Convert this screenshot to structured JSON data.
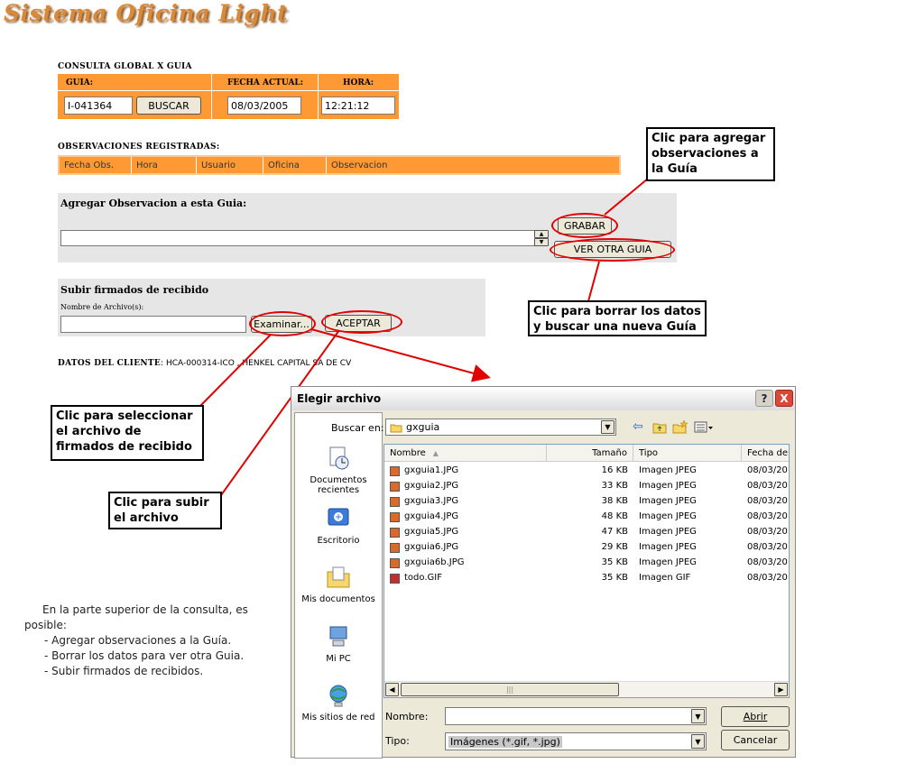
{
  "app": {
    "title": "Sistema Oficina Light"
  },
  "consulta": {
    "section_label": "CONSULTA GLOBAL X GUIA",
    "guia_label": "GUIA:",
    "fecha_label": "FECHA ACTUAL:",
    "hora_label": "HORA:",
    "guia_value": "I-041364",
    "buscar_label": "BUSCAR",
    "fecha_value": "08/03/2005",
    "hora_value": "12:21:12"
  },
  "observaciones": {
    "section_label": "OBSERVACIONES REGISTRADAS:",
    "columns": [
      "Fecha Obs.",
      "Hora",
      "Usuario",
      "Oficina",
      "Observacion"
    ]
  },
  "agregar": {
    "title": "Agregar Observacion a esta Guia:",
    "grabar_label": "GRABAR",
    "ver_otra_label": "VER OTRA GUIA"
  },
  "subir": {
    "title": "Subir firmados de recibido",
    "archivo_label": "Nombre de Archivo(s):",
    "examinar_label": "Examinar...",
    "aceptar_label": "ACEPTAR"
  },
  "cliente": {
    "label": "DATOS DEL CLIENTE",
    "value": ": HCA-000314-ICO , HENKEL CAPITAL SA DE CV"
  },
  "callouts": {
    "agregar": "Clic para agregar observaciones a la Guía",
    "borrar": "Clic para borrar los datos y buscar una nueva Guía",
    "seleccionar": "Clic para seleccionar el archivo de firmados de recibido",
    "subir": "Clic para subir el archivo"
  },
  "description": {
    "intro": "En la parte superior de la consulta, es posible:",
    "items": [
      "- Agregar observaciones a la Guía.",
      "- Borrar los datos para ver otra Guia.",
      "- Subir firmados de recibidos."
    ]
  },
  "dialog": {
    "title": "Elegir archivo",
    "help_label": "?",
    "close_label": "X",
    "buscar_en_label": "Buscar en:",
    "folder": "gxguia",
    "places": [
      "Documentos recientes",
      "Escritorio",
      "Mis documentos",
      "Mi PC",
      "Mis sitios de red"
    ],
    "columns": {
      "name": "Nombre",
      "size": "Tamaño",
      "type": "Tipo",
      "date": "Fecha de"
    },
    "files": [
      {
        "name": "gxguia1.JPG",
        "size": "16 KB",
        "type": "Imagen JPEG",
        "date": "08/03/20"
      },
      {
        "name": "gxguia2.JPG",
        "size": "33 KB",
        "type": "Imagen JPEG",
        "date": "08/03/20"
      },
      {
        "name": "gxguia3.JPG",
        "size": "38 KB",
        "type": "Imagen JPEG",
        "date": "08/03/20"
      },
      {
        "name": "gxguia4.JPG",
        "size": "48 KB",
        "type": "Imagen JPEG",
        "date": "08/03/20"
      },
      {
        "name": "gxguia5.JPG",
        "size": "47 KB",
        "type": "Imagen JPEG",
        "date": "08/03/20"
      },
      {
        "name": "gxguia6.JPG",
        "size": "29 KB",
        "type": "Imagen JPEG",
        "date": "08/03/20"
      },
      {
        "name": "gxguia6b.JPG",
        "size": "35 KB",
        "type": "Imagen JPEG",
        "date": "08/03/20"
      },
      {
        "name": "todo.GIF",
        "size": "35 KB",
        "type": "Imagen GIF",
        "date": "08/03/20"
      }
    ],
    "nombre_label": "Nombre:",
    "nombre_value": "",
    "tipo_label": "Tipo:",
    "tipo_value": "Imágenes (*.gif, *.jpg)",
    "abrir_label": "Abrir",
    "cancelar_label": "Cancelar"
  },
  "colors": {
    "orange": "#ff9933",
    "callout_red": "#e00000",
    "logo": "#d8893a"
  }
}
